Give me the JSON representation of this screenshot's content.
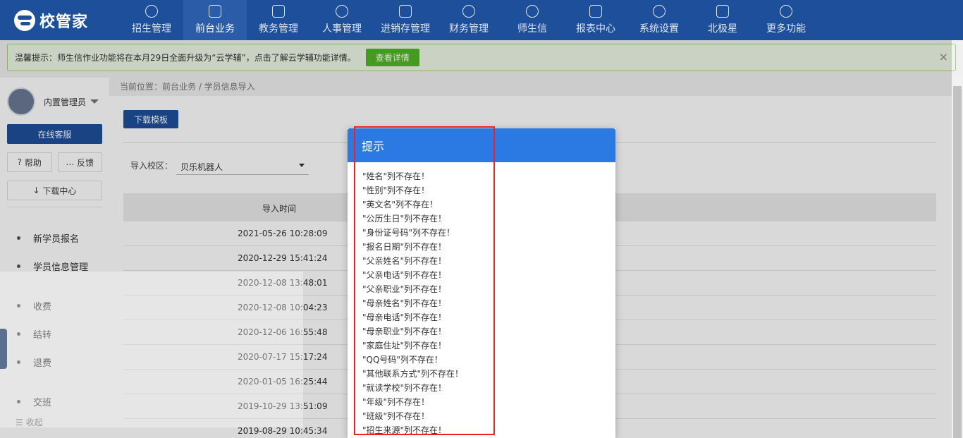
{
  "app": {
    "logo_text": "校管家"
  },
  "nav": {
    "items": [
      {
        "label": "招生管理",
        "icon": "add-user-icon",
        "active": false
      },
      {
        "label": "前台业务",
        "icon": "desk-icon",
        "active": true
      },
      {
        "label": "教务管理",
        "icon": "book-icon",
        "active": false
      },
      {
        "label": "人事管理",
        "icon": "person-icon",
        "active": false
      },
      {
        "label": "进销存管理",
        "icon": "inventory-icon",
        "active": false
      },
      {
        "label": "财务管理",
        "icon": "finance-icon",
        "active": false
      },
      {
        "label": "师生信",
        "icon": "message-icon",
        "active": false
      },
      {
        "label": "报表中心",
        "icon": "report-icon",
        "active": false
      },
      {
        "label": "系统设置",
        "icon": "settings-icon",
        "active": false
      },
      {
        "label": "北极星",
        "icon": "star-icon",
        "active": false
      },
      {
        "label": "更多功能",
        "icon": "more-icon",
        "active": false
      }
    ]
  },
  "notice": {
    "text": "温馨提示：师生信作业功能将在本月29日全面升级为“云学辅”，点击了解云学辅功能详情。",
    "button": "查看详情",
    "close": "×"
  },
  "sidebar": {
    "user": "内置管理员",
    "online_service": "在线客服",
    "help": "帮助",
    "feedback": "反馈",
    "download_center": "下载中心",
    "menu": [
      "新学员报名",
      "学员信息管理",
      "收费",
      "结转",
      "退费",
      "交班"
    ],
    "collapse": "收起"
  },
  "breadcrumb": "当前位置：前台业务 / 学员信息导入",
  "main": {
    "download_template": "下载模板",
    "campus_label": "导入校区：",
    "campus_value": "贝乐机器人",
    "table_header": "导入时间",
    "rows": [
      "2021-05-26 10:28:09",
      "2020-12-29 15:41:24",
      "2020-12-08 13:48:01",
      "2020-12-08 10:04:23",
      "2020-12-06 16:55:48",
      "2020-07-17 15:17:24",
      "2020-01-05 16:25:44",
      "2019-10-29 13:51:09",
      "2019-08-29 10:45:34"
    ]
  },
  "dialog": {
    "title": "提示",
    "messages": [
      "\"姓名\"列不存在！",
      "\"性别\"列不存在！",
      "\"英文名\"列不存在！",
      "\"公历生日\"列不存在！",
      "\"身份证号码\"列不存在！",
      "\"报名日期\"列不存在！",
      "\"父亲姓名\"列不存在！",
      "\"父亲电话\"列不存在！",
      "\"父亲职业\"列不存在！",
      "\"母亲姓名\"列不存在！",
      "\"母亲电话\"列不存在！",
      "\"母亲职业\"列不存在！",
      "\"家庭住址\"列不存在！",
      "\"QQ号码\"列不存在！",
      "\"其他联系方式\"列不存在！",
      "\"就读学校\"列不存在！",
      "\"年级\"列不存在！",
      "\"班级\"列不存在！",
      "\"招生来源\"列不存在！"
    ]
  },
  "colors": {
    "nav_bg": "#1e4f9a",
    "dialog_header": "#2b7ae3",
    "highlight_box": "#e22222",
    "notice_button": "#52b527"
  }
}
